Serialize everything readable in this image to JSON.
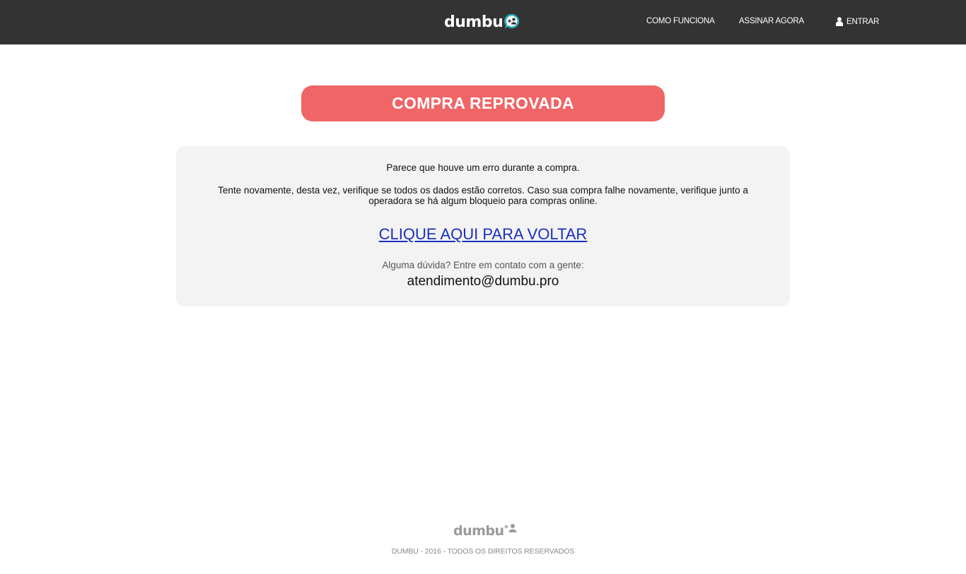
{
  "header": {
    "logo_text": "dumbu",
    "logo_icon": "add-user-bubble-icon",
    "nav": {
      "how_it_works": "COMO FUNCIONA",
      "subscribe": "ASSINAR AGORA",
      "login": "ENTRAR",
      "login_icon": "user-icon"
    }
  },
  "main": {
    "status_banner": "COMPRA REPROVADA",
    "message_intro": "Parece que houve um erro durante a compra.",
    "message_detail": "Tente novamente, desta vez, verifique se todos os dados estão corretos. Caso sua compra falhe novamente, verifique junto a operadora se há algum bloqueio para compras online.",
    "back_link": "CLIQUE AQUI PARA VOLTAR",
    "help_text": "Alguma dúvida? Entre em contato com a gente:",
    "contact_email": "atendimento@dumbu.pro"
  },
  "footer": {
    "logo_text": "dumbu",
    "copyright": "DUMBU - 2016 - TODOS OS DIREITOS RESERVADOS"
  },
  "colors": {
    "topbar": "#333333",
    "banner": "#f06566",
    "panel": "#f3f3f3",
    "link": "#1a2fc0",
    "logo_accent": "#2bb3c0"
  }
}
